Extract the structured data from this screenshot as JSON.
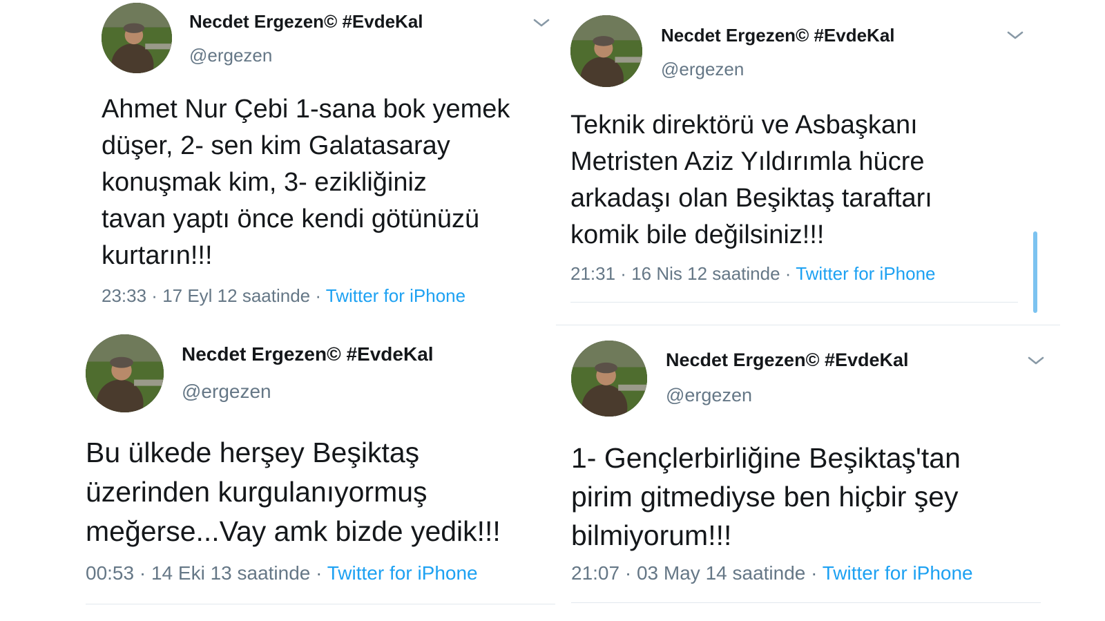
{
  "tweets": [
    {
      "name": "Necdet Ergezen© #EvdeKal",
      "handle": "@ergezen",
      "text_lines": [
        "Ahmet Nur Çebi 1-sana bok yemek",
        "düşer, 2- sen kim Galatasaray",
        "konuşmak kim, 3- ezikliğiniz",
        "tavan yaptı önce kendi götünüzü",
        "kurtarın!!!"
      ],
      "time": "23:33",
      "date": "17 Eyl 12 saatinde",
      "source": "Twitter for iPhone"
    },
    {
      "name": "Necdet Ergezen© #EvdeKal",
      "handle": "@ergezen",
      "text_lines": [
        "Teknik direktörü ve Asbaşkanı",
        "Metristen Aziz Yıldırımla hücre",
        "arkadaşı olan Beşiktaş taraftarı",
        "komik bile değilsiniz!!!"
      ],
      "time": "21:31",
      "date": "16 Nis 12 saatinde",
      "source": "Twitter for iPhone"
    },
    {
      "name": "Necdet Ergezen© #EvdeKal",
      "handle": "@ergezen",
      "text_lines": [
        "Bu ülkede herşey Beşiktaş",
        "üzerinden kurgulanıyormuş",
        "meğerse...Vay amk bizde yedik!!!"
      ],
      "time": "00:53",
      "date": "14 Eki 13 saatinde",
      "source": "Twitter for iPhone"
    },
    {
      "name": "Necdet Ergezen© #EvdeKal",
      "handle": "@ergezen",
      "text_lines": [
        "1- Gençlerbirliğine Beşiktaş'tan",
        "pirim gitmediyse ben hiçbir şey",
        "bilmiyorum!!!"
      ],
      "time": "21:07",
      "date": "03 May 14 saatinde",
      "source": "Twitter for iPhone"
    }
  ],
  "separator": " · ",
  "icons": {
    "more": "chevron-down-icon",
    "avatar": "avatar"
  },
  "colors": {
    "name": "#14171a",
    "secondary": "#657786",
    "link": "#1da1f2",
    "rule": "#e1e8ed",
    "scrollbar": "#7cc3f0"
  }
}
